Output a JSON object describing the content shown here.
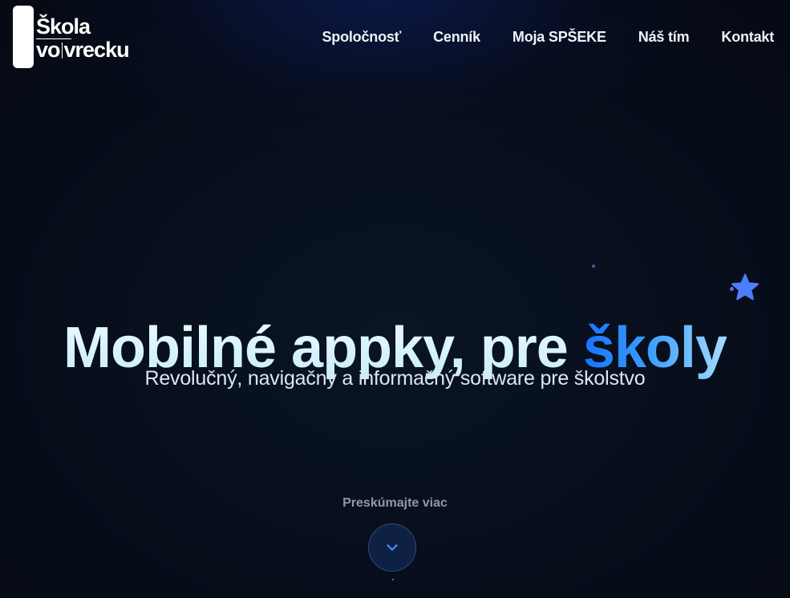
{
  "header": {
    "logo": {
      "line1": "Škola",
      "line2_left": "vo",
      "line2_right": "vrecku"
    },
    "nav": [
      {
        "label": "Spoločnosť"
      },
      {
        "label": "Cenník"
      },
      {
        "label": "Moja SPŠEKE"
      },
      {
        "label": "Náš tím"
      },
      {
        "label": "Kontakt"
      }
    ]
  },
  "hero": {
    "title_main": "Mobilné appky, pre ",
    "title_accent": "školy",
    "subtitle": "Revolučný, navigačný a informačný software pre školstvo",
    "explore_label": "Preskúmajte viac",
    "explore_icon": "chevron-down-icon",
    "star_icon": "star-icon"
  },
  "colors": {
    "background": "#050a14",
    "accent_start": "#1773ff",
    "accent_end": "#a3dcff",
    "title": "#dff6ff",
    "nav_text": "#eef2f8",
    "star": "#4f7dff",
    "button_bg": "#0f2142",
    "button_border": "#2a4a86"
  }
}
